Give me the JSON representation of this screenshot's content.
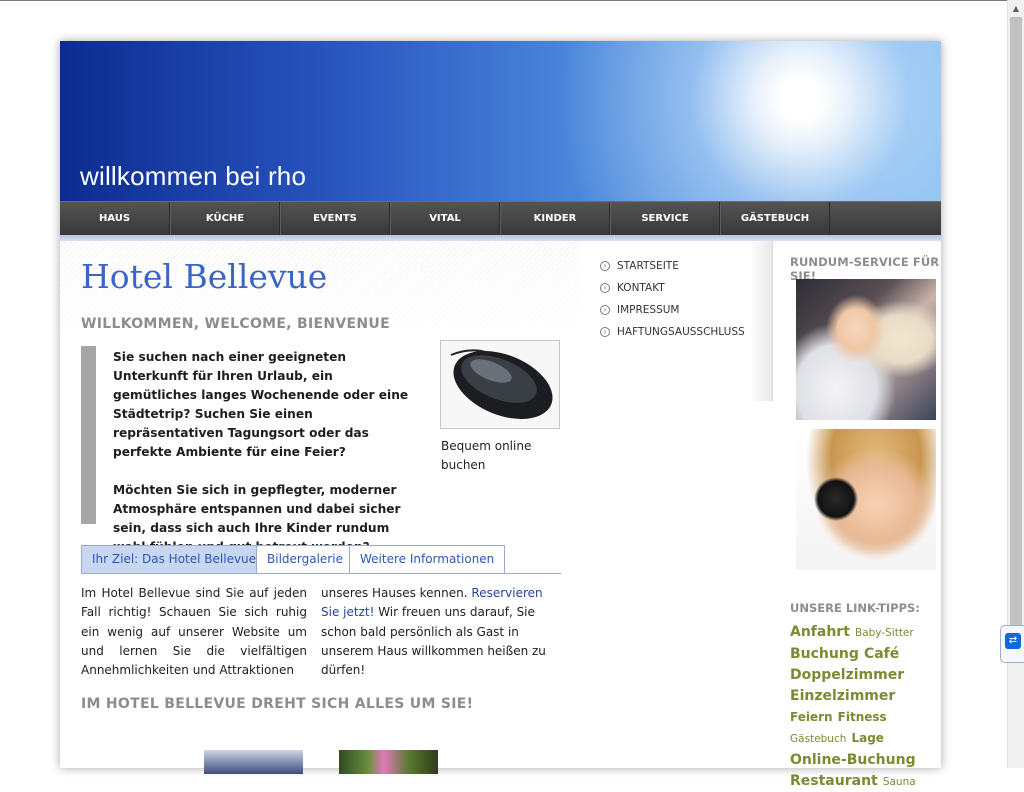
{
  "banner": {
    "title": "willkommen bei rho"
  },
  "nav": {
    "items": [
      "HAUS",
      "KÜCHE",
      "EVENTS",
      "VITAL",
      "KINDER",
      "SERVICE",
      "GÄSTEBUCH"
    ]
  },
  "main": {
    "title": "Hotel Bellevue",
    "welcome": "WILLKOMMEN, WELCOME, BIENVENUE",
    "intro_p1": "Sie suchen nach einer geeigneten Unterkunft für Ihren Urlaub, ein gemütliches langes Wochenende oder eine Städtetrip? Suchen Sie einen repräsentativen Tagungsort oder das perfekte Ambiente für eine Feier?",
    "intro_p2": "Möchten Sie sich in gepflegter, moderner Atmosphäre entspannen und dabei sicher sein, dass sich auch Ihre Kinder rundum wohl fühlen und gut betreut werden?",
    "image_caption": "Bequem online buchen",
    "tabs": [
      "Ihr Ziel: Das Hotel Bellevue",
      "Bildergalerie",
      "Weitere Informationen"
    ],
    "tab_text_left": "Im Hotel Bellevue sind Sie auf jeden Fall richtig! Schauen Sie sich ruhig ein wenig auf unserer Website um und lernen Sie die vielfältigen Annehmlichkeiten und Attraktionen",
    "tab_text_right_pre": "unseres Hauses kennen. ",
    "tab_text_right_link": "Reservieren Sie jetzt!",
    "tab_text_right_post": " Wir freuen uns darauf, Sie schon bald persönlich als Gast in unserem Haus willkommen heißen zu dürfen!",
    "section2": "IM HOTEL BELLEVUE DREHT SICH ALLES UM SIE!"
  },
  "sidemenu": {
    "items": [
      "STARTSEITE",
      "KONTAKT",
      "IMPRESSUM",
      "HAFTUNGSAUSSCHLUSS"
    ]
  },
  "right": {
    "service_head": "RUNDUM-SERVICE FÜR SIE!",
    "linktips_head": "UNSERE LINK-TIPPS:",
    "tags": [
      {
        "text": "Anfahrt",
        "size": "l"
      },
      {
        "text": "Baby-Sitter",
        "size": "s"
      },
      {
        "text": "Buchung",
        "size": "l"
      },
      {
        "text": "Café",
        "size": "l"
      },
      {
        "text": "Doppelzimmer",
        "size": "l"
      },
      {
        "text": "Einzelzimmer",
        "size": "l"
      },
      {
        "text": "Feiern",
        "size": "m"
      },
      {
        "text": "Fitness",
        "size": "m"
      },
      {
        "text": "Gästebuch",
        "size": "s"
      },
      {
        "text": "Lage",
        "size": "m"
      },
      {
        "text": "Online-Buchung",
        "size": "l"
      },
      {
        "text": "Restaurant",
        "size": "l"
      },
      {
        "text": "Sauna",
        "size": "s"
      }
    ]
  },
  "system": {
    "remote_icon": "teamviewer-icon"
  }
}
